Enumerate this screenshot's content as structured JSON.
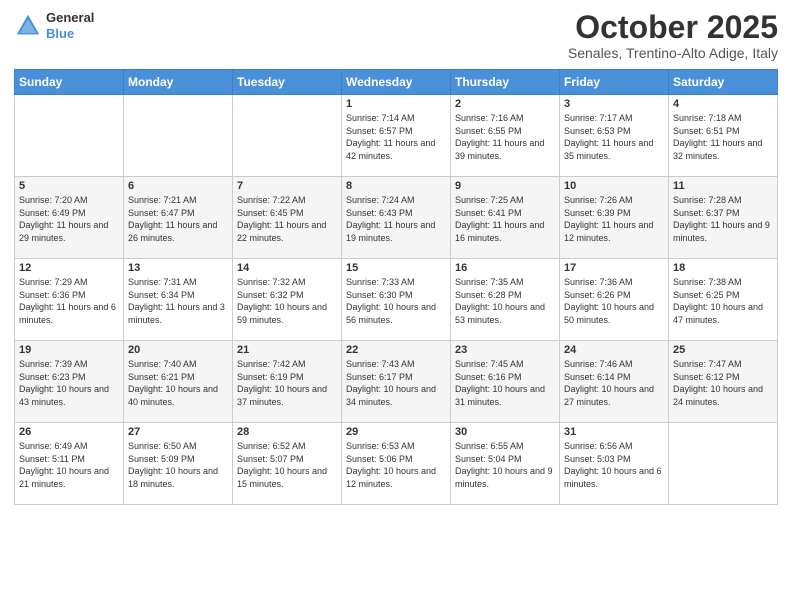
{
  "header": {
    "logo_general": "General",
    "logo_blue": "Blue",
    "month": "October 2025",
    "location": "Senales, Trentino-Alto Adige, Italy"
  },
  "days_of_week": [
    "Sunday",
    "Monday",
    "Tuesday",
    "Wednesday",
    "Thursday",
    "Friday",
    "Saturday"
  ],
  "weeks": [
    [
      {
        "day": "",
        "info": ""
      },
      {
        "day": "",
        "info": ""
      },
      {
        "day": "",
        "info": ""
      },
      {
        "day": "1",
        "info": "Sunrise: 7:14 AM\nSunset: 6:57 PM\nDaylight: 11 hours and 42 minutes."
      },
      {
        "day": "2",
        "info": "Sunrise: 7:16 AM\nSunset: 6:55 PM\nDaylight: 11 hours and 39 minutes."
      },
      {
        "day": "3",
        "info": "Sunrise: 7:17 AM\nSunset: 6:53 PM\nDaylight: 11 hours and 35 minutes."
      },
      {
        "day": "4",
        "info": "Sunrise: 7:18 AM\nSunset: 6:51 PM\nDaylight: 11 hours and 32 minutes."
      }
    ],
    [
      {
        "day": "5",
        "info": "Sunrise: 7:20 AM\nSunset: 6:49 PM\nDaylight: 11 hours and 29 minutes."
      },
      {
        "day": "6",
        "info": "Sunrise: 7:21 AM\nSunset: 6:47 PM\nDaylight: 11 hours and 26 minutes."
      },
      {
        "day": "7",
        "info": "Sunrise: 7:22 AM\nSunset: 6:45 PM\nDaylight: 11 hours and 22 minutes."
      },
      {
        "day": "8",
        "info": "Sunrise: 7:24 AM\nSunset: 6:43 PM\nDaylight: 11 hours and 19 minutes."
      },
      {
        "day": "9",
        "info": "Sunrise: 7:25 AM\nSunset: 6:41 PM\nDaylight: 11 hours and 16 minutes."
      },
      {
        "day": "10",
        "info": "Sunrise: 7:26 AM\nSunset: 6:39 PM\nDaylight: 11 hours and 12 minutes."
      },
      {
        "day": "11",
        "info": "Sunrise: 7:28 AM\nSunset: 6:37 PM\nDaylight: 11 hours and 9 minutes."
      }
    ],
    [
      {
        "day": "12",
        "info": "Sunrise: 7:29 AM\nSunset: 6:36 PM\nDaylight: 11 hours and 6 minutes."
      },
      {
        "day": "13",
        "info": "Sunrise: 7:31 AM\nSunset: 6:34 PM\nDaylight: 11 hours and 3 minutes."
      },
      {
        "day": "14",
        "info": "Sunrise: 7:32 AM\nSunset: 6:32 PM\nDaylight: 10 hours and 59 minutes."
      },
      {
        "day": "15",
        "info": "Sunrise: 7:33 AM\nSunset: 6:30 PM\nDaylight: 10 hours and 56 minutes."
      },
      {
        "day": "16",
        "info": "Sunrise: 7:35 AM\nSunset: 6:28 PM\nDaylight: 10 hours and 53 minutes."
      },
      {
        "day": "17",
        "info": "Sunrise: 7:36 AM\nSunset: 6:26 PM\nDaylight: 10 hours and 50 minutes."
      },
      {
        "day": "18",
        "info": "Sunrise: 7:38 AM\nSunset: 6:25 PM\nDaylight: 10 hours and 47 minutes."
      }
    ],
    [
      {
        "day": "19",
        "info": "Sunrise: 7:39 AM\nSunset: 6:23 PM\nDaylight: 10 hours and 43 minutes."
      },
      {
        "day": "20",
        "info": "Sunrise: 7:40 AM\nSunset: 6:21 PM\nDaylight: 10 hours and 40 minutes."
      },
      {
        "day": "21",
        "info": "Sunrise: 7:42 AM\nSunset: 6:19 PM\nDaylight: 10 hours and 37 minutes."
      },
      {
        "day": "22",
        "info": "Sunrise: 7:43 AM\nSunset: 6:17 PM\nDaylight: 10 hours and 34 minutes."
      },
      {
        "day": "23",
        "info": "Sunrise: 7:45 AM\nSunset: 6:16 PM\nDaylight: 10 hours and 31 minutes."
      },
      {
        "day": "24",
        "info": "Sunrise: 7:46 AM\nSunset: 6:14 PM\nDaylight: 10 hours and 27 minutes."
      },
      {
        "day": "25",
        "info": "Sunrise: 7:47 AM\nSunset: 6:12 PM\nDaylight: 10 hours and 24 minutes."
      }
    ],
    [
      {
        "day": "26",
        "info": "Sunrise: 6:49 AM\nSunset: 5:11 PM\nDaylight: 10 hours and 21 minutes."
      },
      {
        "day": "27",
        "info": "Sunrise: 6:50 AM\nSunset: 5:09 PM\nDaylight: 10 hours and 18 minutes."
      },
      {
        "day": "28",
        "info": "Sunrise: 6:52 AM\nSunset: 5:07 PM\nDaylight: 10 hours and 15 minutes."
      },
      {
        "day": "29",
        "info": "Sunrise: 6:53 AM\nSunset: 5:06 PM\nDaylight: 10 hours and 12 minutes."
      },
      {
        "day": "30",
        "info": "Sunrise: 6:55 AM\nSunset: 5:04 PM\nDaylight: 10 hours and 9 minutes."
      },
      {
        "day": "31",
        "info": "Sunrise: 6:56 AM\nSunset: 5:03 PM\nDaylight: 10 hours and 6 minutes."
      },
      {
        "day": "",
        "info": ""
      }
    ]
  ]
}
